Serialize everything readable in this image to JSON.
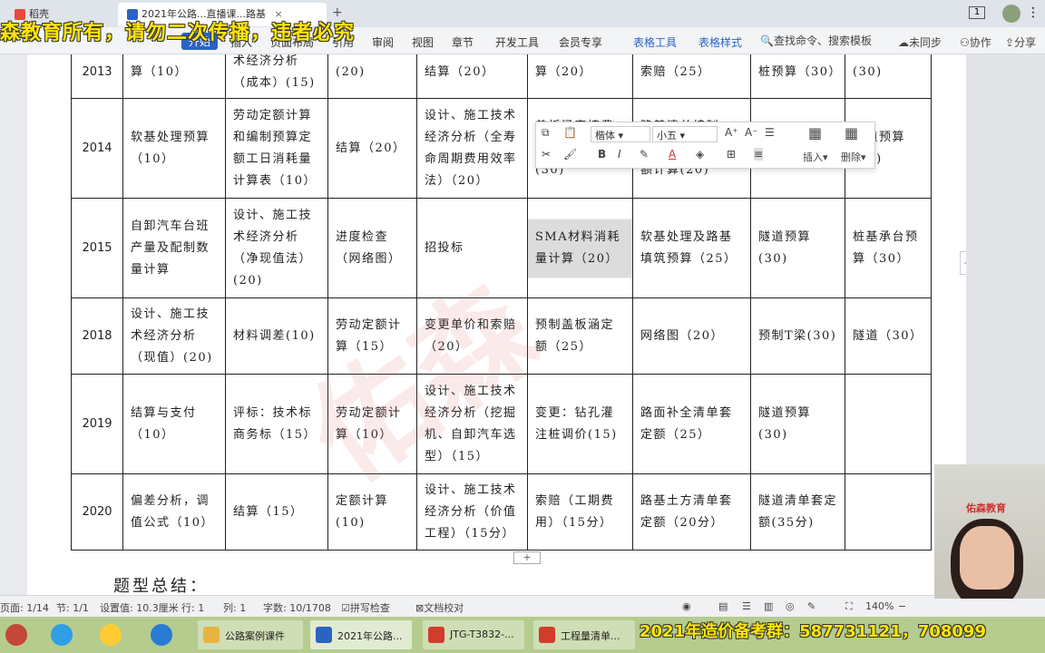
{
  "title_tabs": [
    {
      "label": "稻壳",
      "icon": "docer-icon",
      "color": "#e8493a"
    },
    {
      "label": "2021年公路...直播课...路基",
      "icon": "wps-writer-icon",
      "color": "#2b63c4"
    }
  ],
  "watermark_top": "森教育所有，请勿二次传播，违者必究",
  "ribbon": {
    "tabs": [
      "开始",
      "插入",
      "页面布局",
      "引用",
      "审阅",
      "视图",
      "章节",
      "开发工具",
      "会员专享",
      "表格工具",
      "表格样式"
    ],
    "search": "查找命令、搜索模板",
    "unsynced": "未同步",
    "collaborate": "协作",
    "share": "分享"
  },
  "table": {
    "rows": [
      {
        "year": "2013",
        "cells": [
          "算（10）",
          "术经济分析（成本）(15)",
          "(20)",
          "结算（20）",
          "算（20）",
          "索赔（25）",
          "桩预算（30）",
          "(30)"
        ]
      },
      {
        "year": "2014",
        "cells": [
          "软基处理预算（10）",
          "劳动定额计算和编制预算定额工日消耗量计算表（10）",
          "结算（20）",
          "设计、施工技术经济分析（全寿命周期费用效率法）（20）",
          "盖板涵直接费计算和预算(30)",
          "路基清单编制、综合单价和总金额计算(20)",
          "双导梁架设T梁预算(30)",
          "隧道预算(30)"
        ]
      },
      {
        "year": "2015",
        "cells": [
          "自卸汽车台班产量及配制数量计算",
          "设计、施工技术经济分析（净现值法）(20)",
          "进度检查（网络图）",
          "招投标",
          "SMA材料消耗量计算（20）",
          "软基处理及路基填筑预算（25）",
          "隧道预算(30)",
          "桩基承台预算（30）"
        ]
      },
      {
        "year": "2018",
        "cells": [
          "设计、施工技术经济分析（现值）(20)",
          "材料调差(10)",
          "劳动定额计算（15）",
          "变更单价和索赔（20）",
          "预制盖板涵定额（25）",
          "网络图（20）",
          "预制T梁(30)",
          "隧道（30）"
        ]
      },
      {
        "year": "2019",
        "cells": [
          "结算与支付（10）",
          "评标：技术标商务标（15）",
          "劳动定额计算（10）",
          "设计、施工技术经济分析（挖掘机、自卸汽车选型）（15）",
          "变更：钻孔灌注桩调价(15)",
          "路面补全清单套定额（25）",
          "隧道预算(30)",
          ""
        ]
      },
      {
        "year": "2020",
        "cells": [
          "偏差分析，调值公式（10）",
          "结算（15）",
          "定额计算(10)",
          "设计、施工技术经济分析（价值工程）（15分）",
          "索赔（工期费用）（15分）",
          "路基土方清单套定额（20分）",
          "隧道清单套定额(35分)",
          ""
        ]
      }
    ]
  },
  "summary_heading": "题型总结：",
  "float_toolbar": {
    "font_name": "楷体",
    "font_size": "小五",
    "insert": "插入",
    "delete": "删除"
  },
  "status_bar": {
    "page": "页面: 1/14",
    "section": "节: 1/1",
    "setting": "设置值: 10.3厘米",
    "row": "行: 1",
    "col": "列: 1",
    "word_count": "字数: 10/1708",
    "spell_check": "拼写检查",
    "doc_proof": "文档校对",
    "zoom": "140%"
  },
  "taskbar": {
    "items": [
      {
        "label": "公路案例课件",
        "icon": "folder-icon",
        "color": "#e8b441"
      },
      {
        "label": "2021年公路...",
        "icon": "wps-writer-icon",
        "color": "#2b63c4"
      },
      {
        "label": "JTG-T3832-...",
        "icon": "pdf-icon",
        "color": "#d33b2c"
      },
      {
        "label": "工程量清单...",
        "icon": "pdf-icon",
        "color": "#d33b2c"
      }
    ]
  },
  "watermark_bottom": "2021年造价备考群：587731121，708099",
  "webcam_logo": "佑森教育"
}
